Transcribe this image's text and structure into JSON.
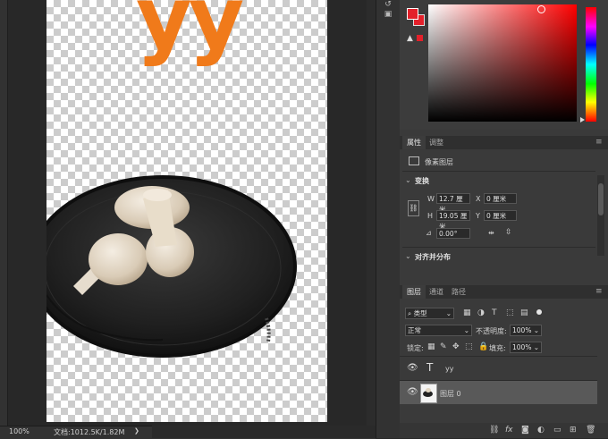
{
  "document": {
    "layer_text": "yy",
    "zoom": "100%",
    "doc_info": "文档:1012.5K/1.82M",
    "status_arrow": "❯"
  },
  "colors": {
    "foreground": "#e3202a",
    "text_orange": "#f07a1a"
  },
  "properties": {
    "tabs": [
      "属性",
      "调整"
    ],
    "layer_type": "像素图层",
    "transform_title": "变换",
    "w_label": "W",
    "w_value": "12.7 厘米",
    "x_label": "X",
    "x_value": "0 厘米",
    "h_label": "H",
    "h_value": "19.05 厘米",
    "y_label": "Y",
    "y_value": "0 厘米",
    "angle_value": "0.00°",
    "align_title": "对齐并分布"
  },
  "layers": {
    "tabs": [
      "图层",
      "通道",
      "路径"
    ],
    "filter_kind": "类型",
    "blend_mode": "正常",
    "opacity_label": "不透明度:",
    "opacity_value": "100%",
    "lock_label": "锁定:",
    "fill_label": "填充:",
    "fill_value": "100%",
    "items": [
      {
        "name": "yy",
        "kind": "text",
        "visible": true,
        "selected": false
      },
      {
        "name": "图层 0",
        "kind": "pixel",
        "visible": true,
        "selected": true
      }
    ]
  },
  "icons": {
    "eye": "👁",
    "text_layer": "T",
    "link": "⛓",
    "warning": "▲",
    "menu": "≡",
    "chevron": "❯",
    "chevron_down": "⌄"
  }
}
